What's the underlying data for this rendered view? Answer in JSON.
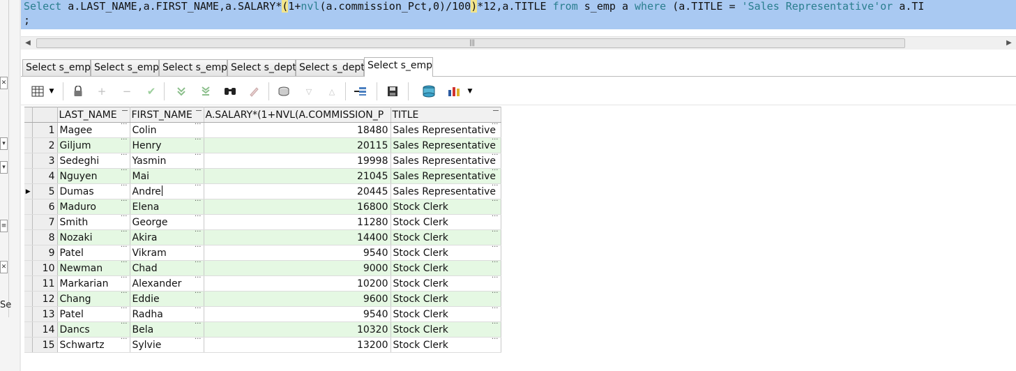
{
  "editor": {
    "line1": {
      "t1": "Select",
      "t2": " a.LAST_NAME,a.FIRST_NAME,a.SALARY*",
      "t3": "(",
      "t4": "1+",
      "t5": "nvl",
      "t6": "(a.commission_Pct,0)/100",
      "t7": ")",
      "t8": "*12,a.TITLE ",
      "t9": "from",
      "t10": " s_emp a ",
      "t11": "where",
      "t12": " (a.TITLE = ",
      "t13": "'Sales Representative'",
      "t14": "or",
      "t15": " a.TI"
    },
    "line2": ";"
  },
  "tabs": [
    "Select s_emp",
    "Select s_emp",
    "Select s_emp",
    "Select s_dept",
    "Select s_dept",
    "Select s_emp"
  ],
  "active_tab": 5,
  "left_strip": {
    "partial_text": "Se"
  },
  "toolbar": {
    "icons": [
      "grid-view-icon",
      "dropdown-icon",
      "lock-icon",
      "insert-record-icon",
      "delete-record-icon",
      "post-changes-icon",
      "fetch-next-icon",
      "fetch-all-icon",
      "find-icon",
      "clear-icon",
      "query-by-example-icon",
      "filter-icon",
      "sort-icon",
      "single-record-view-icon",
      "save-icon",
      "export-icon",
      "chart-icon",
      "dropdown-icon"
    ]
  },
  "grid": {
    "columns": [
      "LAST_NAME",
      "FIRST_NAME",
      "A.SALARY*(1+NVL(A.COMMISSION_P",
      "TITLE"
    ],
    "current_row": 5,
    "rows": [
      {
        "n": "1",
        "last": "Magee",
        "first": "Colin",
        "sal": "18480",
        "title": "Sales Representative"
      },
      {
        "n": "2",
        "last": "Giljum",
        "first": "Henry",
        "sal": "20115",
        "title": "Sales Representative"
      },
      {
        "n": "3",
        "last": "Sedeghi",
        "first": "Yasmin",
        "sal": "19998",
        "title": "Sales Representative"
      },
      {
        "n": "4",
        "last": "Nguyen",
        "first": "Mai",
        "sal": "21045",
        "title": "Sales Representative"
      },
      {
        "n": "5",
        "last": "Dumas",
        "first": "Andre",
        "sal": "20445",
        "title": "Sales Representative"
      },
      {
        "n": "6",
        "last": "Maduro",
        "first": "Elena",
        "sal": "16800",
        "title": "Stock Clerk"
      },
      {
        "n": "7",
        "last": "Smith",
        "first": "George",
        "sal": "11280",
        "title": "Stock Clerk"
      },
      {
        "n": "8",
        "last": "Nozaki",
        "first": "Akira",
        "sal": "14400",
        "title": "Stock Clerk"
      },
      {
        "n": "9",
        "last": "Patel",
        "first": "Vikram",
        "sal": "9540",
        "title": "Stock Clerk"
      },
      {
        "n": "10",
        "last": "Newman",
        "first": "Chad",
        "sal": "9000",
        "title": "Stock Clerk"
      },
      {
        "n": "11",
        "last": "Markarian",
        "first": "Alexander",
        "sal": "10200",
        "title": "Stock Clerk"
      },
      {
        "n": "12",
        "last": "Chang",
        "first": "Eddie",
        "sal": "9600",
        "title": "Stock Clerk"
      },
      {
        "n": "13",
        "last": "Patel",
        "first": "Radha",
        "sal": "9540",
        "title": "Stock Clerk"
      },
      {
        "n": "14",
        "last": "Dancs",
        "first": "Bela",
        "sal": "10320",
        "title": "Stock Clerk"
      },
      {
        "n": "15",
        "last": "Schwartz",
        "first": "Sylvie",
        "sal": "13200",
        "title": "Stock Clerk"
      }
    ]
  }
}
